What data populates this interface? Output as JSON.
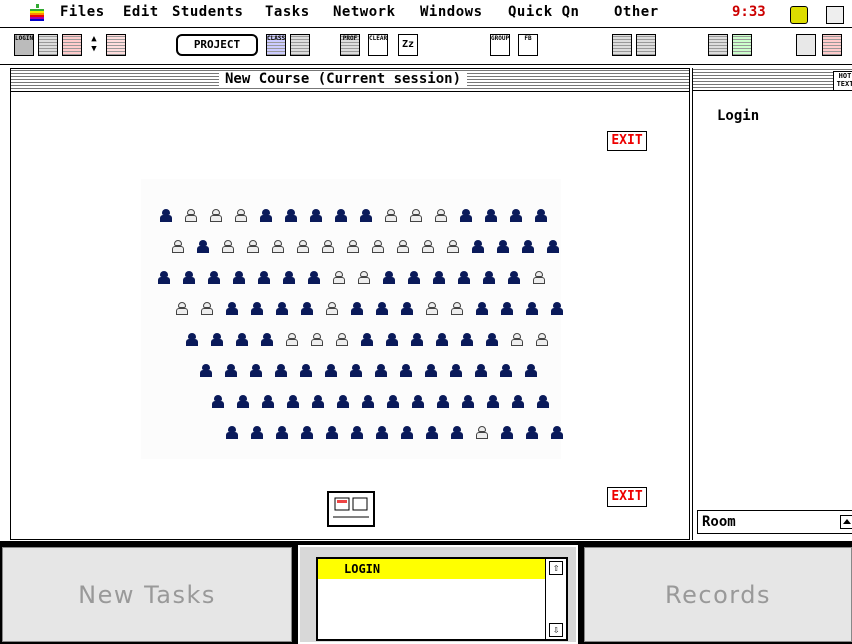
{
  "menubar": {
    "items": [
      "Files",
      "Edit",
      "Students",
      "Tasks",
      "Network",
      "Windows",
      "Quick Qn",
      "Other"
    ],
    "clock": "9:33"
  },
  "toolbar": {
    "project_label": "PROJECT",
    "icons": [
      "login-icon",
      "roster-icon",
      "timer-icon",
      "up-down-arrows-icon",
      "seating-icon",
      "class-icon",
      "stat-icon",
      "proj-icon",
      "clear-icon",
      "sleep-icon",
      "group-icon",
      "fb-icon",
      "window-icon-1",
      "window-icon-2",
      "chart-icon-1",
      "chart-icon-2",
      "blank-icon",
      "red-icon"
    ],
    "badge_texts": {
      "login": "LOGIN",
      "class": "CLASS",
      "prof": "PROF",
      "clear": "CLEAR",
      "group": "GROUP",
      "fb": "FB",
      "hot": "HOT TEXT"
    }
  },
  "main_window": {
    "title": "New Course (Current session)",
    "exit_label": "EXIT",
    "seat_rows": [
      [
        1,
        0,
        0,
        0,
        1,
        1,
        1,
        1,
        1,
        0,
        0,
        0,
        1,
        1,
        1,
        1
      ],
      [
        0,
        1,
        0,
        0,
        0,
        0,
        0,
        0,
        0,
        0,
        0,
        0,
        1,
        1,
        1,
        1
      ],
      [
        1,
        1,
        1,
        1,
        1,
        1,
        1,
        0,
        0,
        1,
        1,
        1,
        1,
        1,
        1,
        0
      ],
      [
        0,
        0,
        1,
        1,
        1,
        1,
        0,
        1,
        1,
        1,
        0,
        0,
        1,
        1,
        1,
        1
      ],
      [
        1,
        1,
        1,
        1,
        0,
        0,
        0,
        1,
        1,
        1,
        1,
        1,
        1,
        0,
        0
      ],
      [
        1,
        1,
        1,
        1,
        1,
        1,
        1,
        1,
        1,
        1,
        1,
        1,
        1,
        1
      ],
      [
        1,
        1,
        1,
        1,
        1,
        1,
        1,
        1,
        1,
        1,
        1,
        1,
        1,
        1
      ],
      [
        1,
        1,
        1,
        1,
        1,
        1,
        1,
        1,
        1,
        1,
        0,
        1,
        1,
        1
      ]
    ]
  },
  "right_panel": {
    "login_label": "Login",
    "room_label": "Room"
  },
  "bottom": {
    "new_tasks_label": "New Tasks",
    "records_label": "Records",
    "list_items": [
      "LOGIN"
    ]
  }
}
